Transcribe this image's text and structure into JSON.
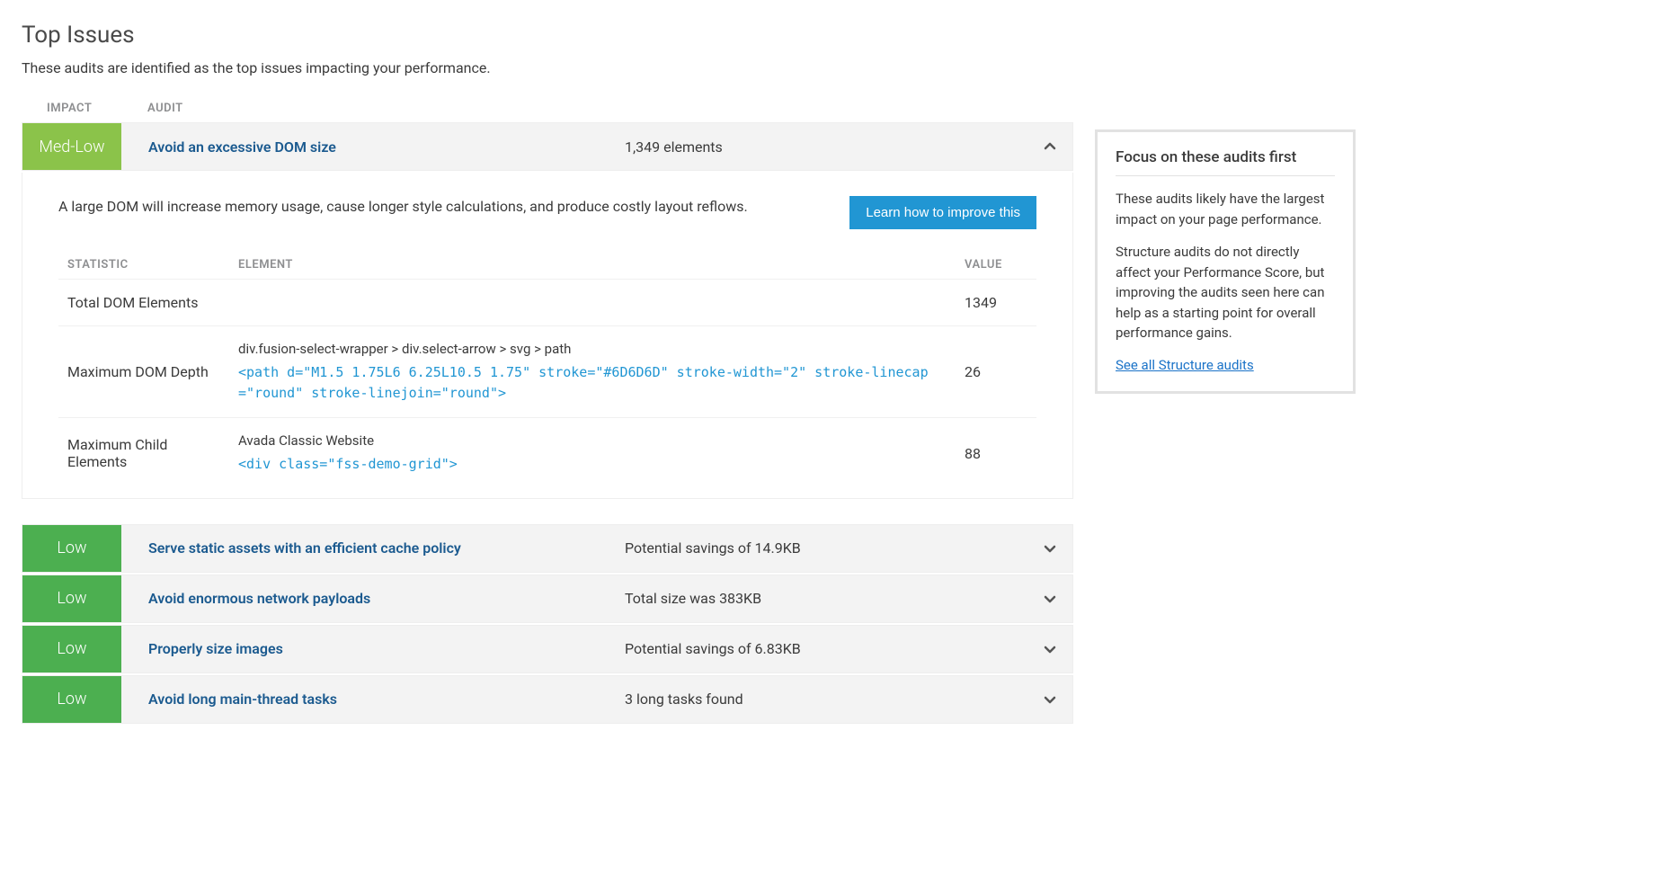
{
  "section": {
    "title": "Top Issues",
    "subtitle": "These audits are identified as the top issues impacting your performance."
  },
  "headers": {
    "impact": "IMPACT",
    "audit": "AUDIT",
    "statistic": "STATISTIC",
    "element": "ELEMENT",
    "value": "VALUE"
  },
  "audits": [
    {
      "impact": "Med-Low",
      "title": "Avoid an excessive DOM size",
      "metric": "1,349 elements",
      "expanded": true,
      "desc": "A large DOM will increase memory usage, cause longer style calculations, and produce costly layout reflows.",
      "learn_label": "Learn how to improve this",
      "stats": [
        {
          "name": "Total DOM Elements",
          "path": "",
          "code": "",
          "value": "1349"
        },
        {
          "name": "Maximum DOM Depth",
          "path": "div.fusion-select-wrapper > div.select-arrow > svg > path",
          "code": "<path d=\"M1.5 1.75L6 6.25L10.5 1.75\" stroke=\"#6D6D6D\" stroke-width=\"2\" stroke-linecap=\"round\" stroke-linejoin=\"round\">",
          "value": "26"
        },
        {
          "name": "Maximum Child Elements",
          "path": "Avada Classic Website",
          "code": "<div class=\"fss-demo-grid\">",
          "value": "88"
        }
      ]
    },
    {
      "impact": "Low",
      "title": "Serve static assets with an efficient cache policy",
      "metric": "Potential savings of 14.9KB",
      "expanded": false
    },
    {
      "impact": "Low",
      "title": "Avoid enormous network payloads",
      "metric": "Total size was 383KB",
      "expanded": false
    },
    {
      "impact": "Low",
      "title": "Properly size images",
      "metric": "Potential savings of 6.83KB",
      "expanded": false
    },
    {
      "impact": "Low",
      "title": "Avoid long main-thread tasks",
      "metric": "3 long tasks found",
      "expanded": false
    }
  ],
  "sidebar": {
    "title": "Focus on these audits first",
    "p1": "These audits likely have the largest impact on your page performance.",
    "p2": "Structure audits do not directly affect your Performance Score, but improving the audits seen here can help as a starting point for overall performance gains.",
    "link": "See all Structure audits"
  }
}
